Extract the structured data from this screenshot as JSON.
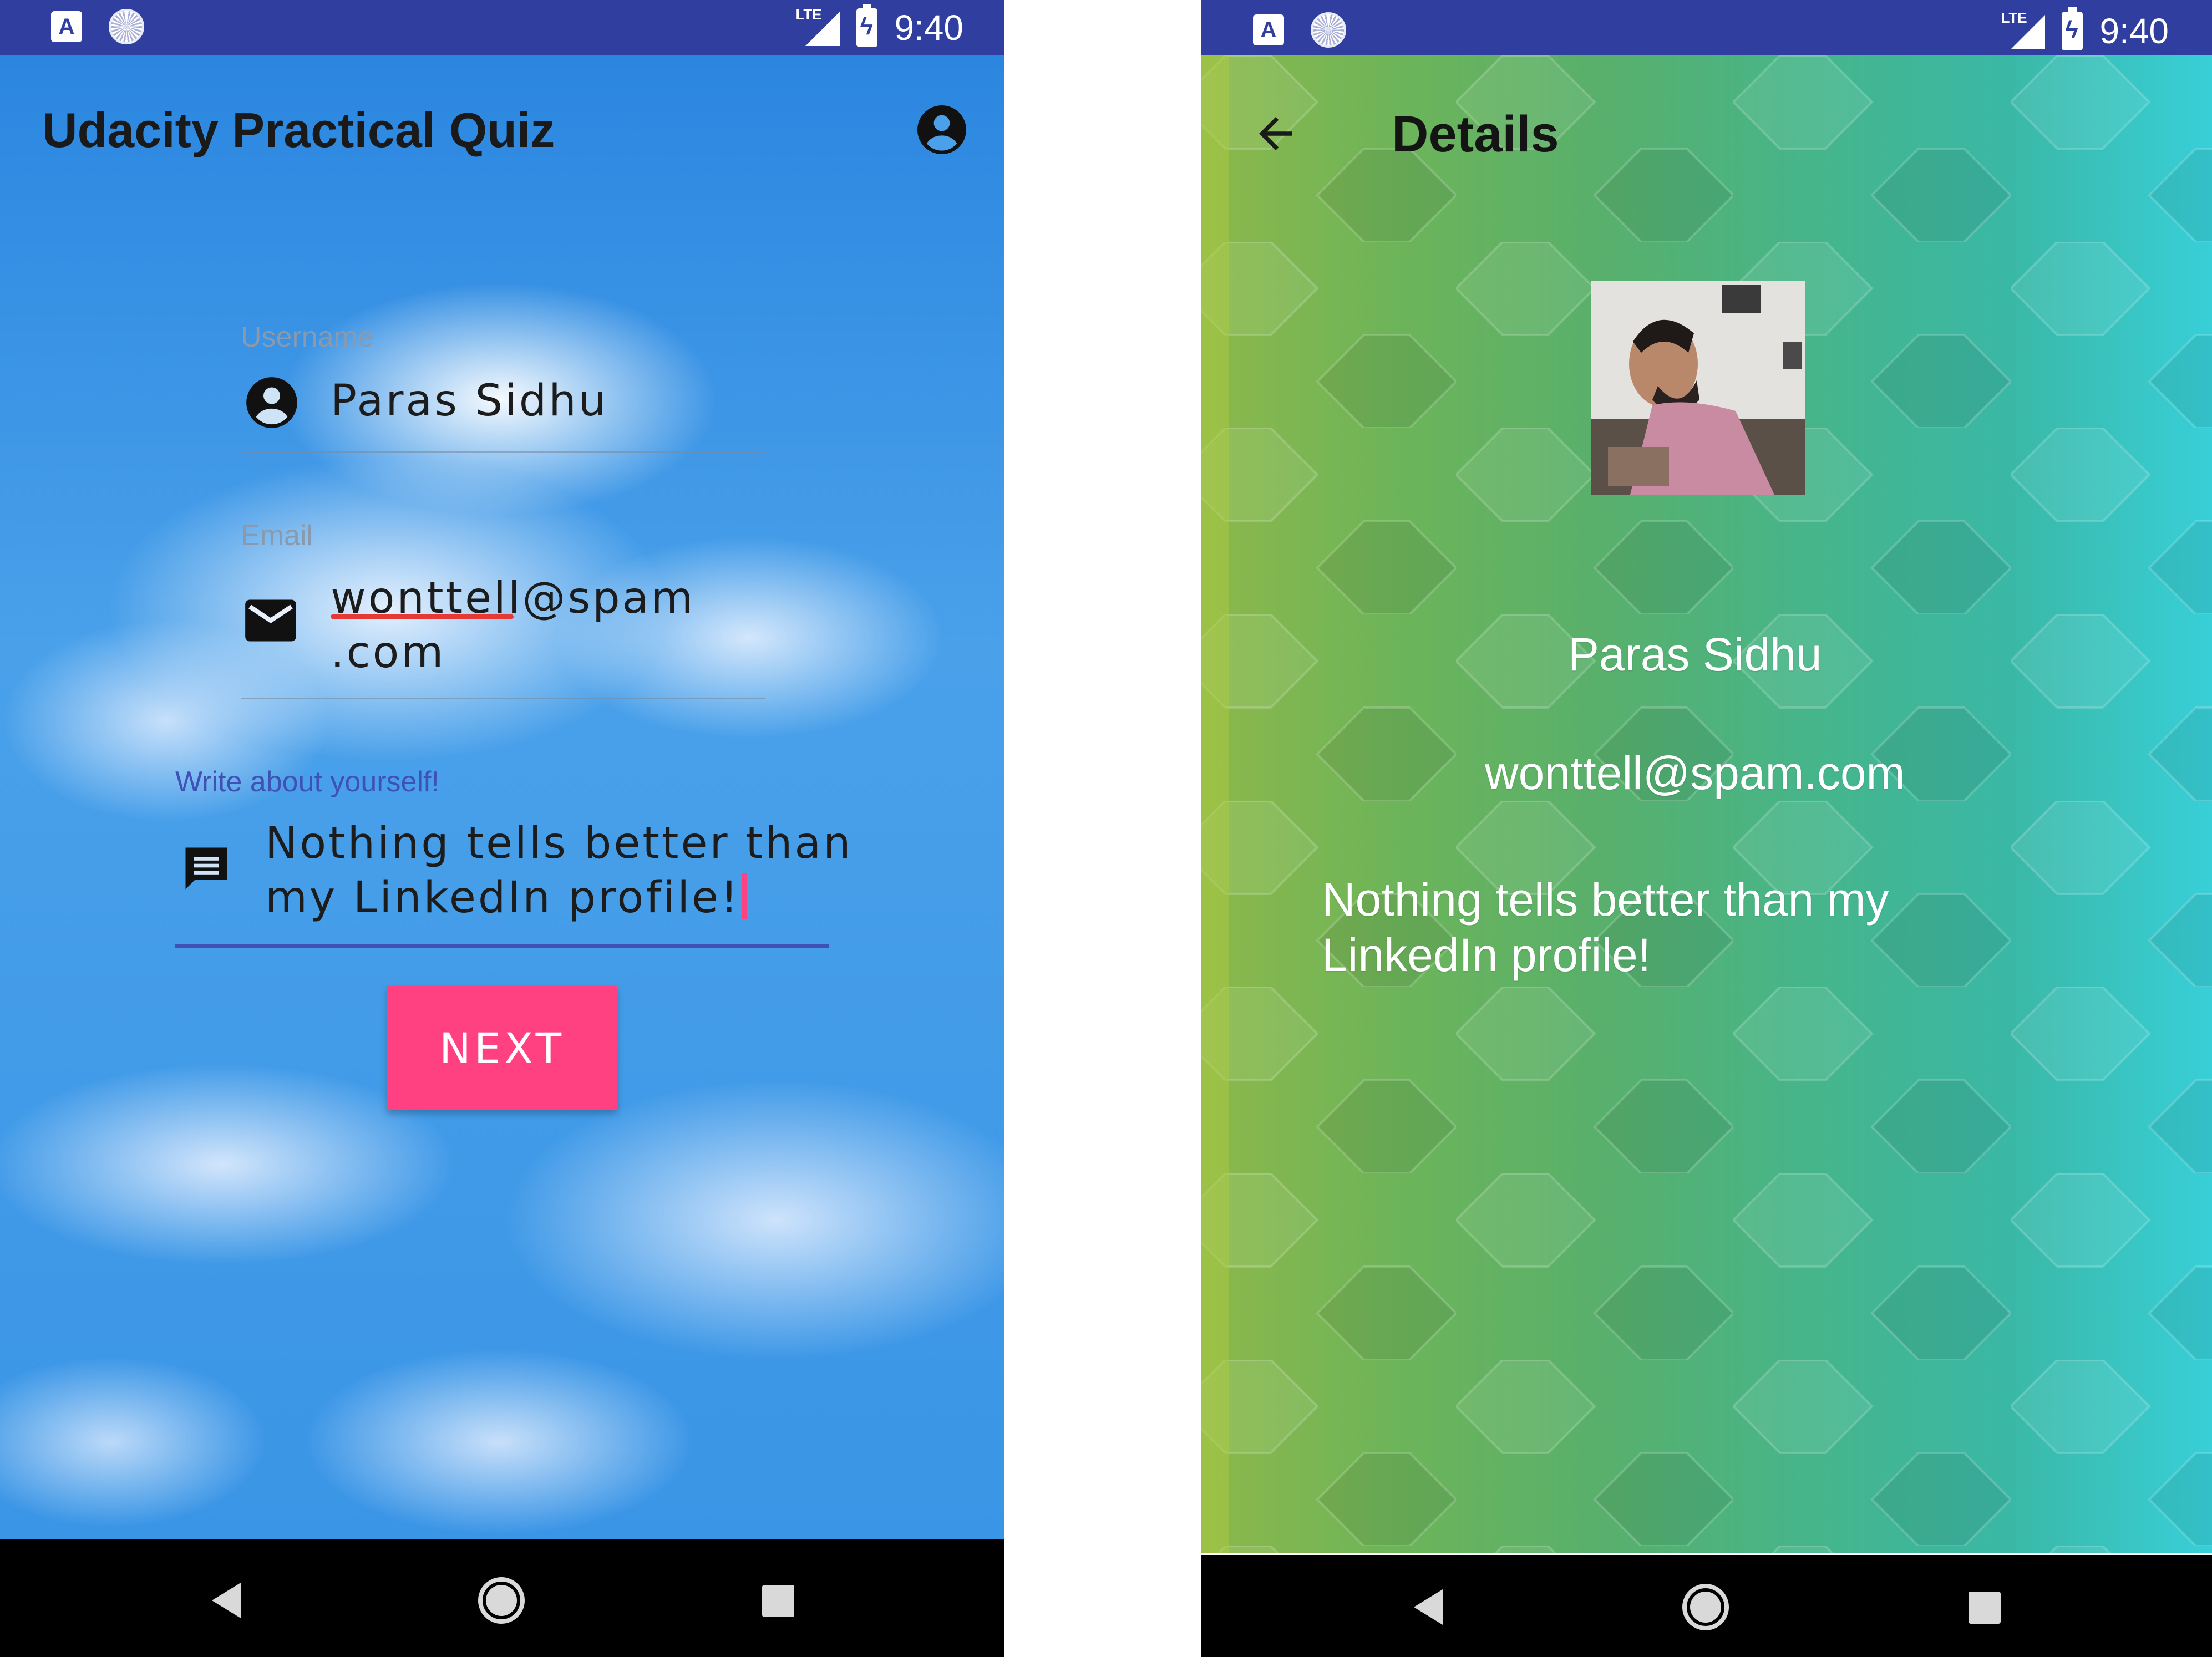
{
  "status_bar": {
    "time": "9:40",
    "network": "LTE",
    "icons": [
      "app-a-icon",
      "sync-icon",
      "signal-icon",
      "battery-charging-icon"
    ]
  },
  "left_screen": {
    "app_title": "Udacity Practical Quiz",
    "account_icon": "account-circle-icon",
    "username": {
      "label": "Username",
      "value": "Paras Sidhu",
      "icon": "account-circle-icon"
    },
    "email": {
      "label": "Email",
      "value_line1": "wonttell@spam",
      "value_line2": ".com",
      "icon": "mail-icon"
    },
    "about": {
      "label": "Write about yourself!",
      "value_line1": "Nothing tells better than",
      "value_line2": "my LinkedIn profile!",
      "icon": "message-icon"
    },
    "next_button": "NEXT",
    "colors": {
      "status_bar": "#303f9f",
      "accent": "#ff4081",
      "focus_line": "#3f51b5"
    }
  },
  "right_screen": {
    "title": "Details",
    "back_icon": "arrow-back-icon",
    "photo": "profile-photo",
    "name": "Paras Sidhu",
    "email": "wonttell@spam.com",
    "about_line1": "Nothing tells better than my",
    "about_line2": "LinkedIn profile!"
  },
  "nav_bar": {
    "icons": [
      "back-icon",
      "home-icon",
      "recents-icon"
    ]
  }
}
